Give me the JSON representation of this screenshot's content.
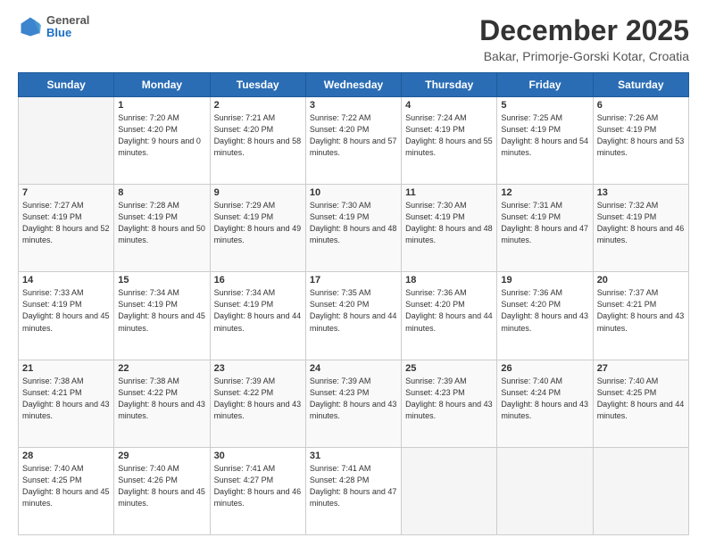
{
  "header": {
    "logo": {
      "general": "General",
      "blue": "Blue"
    },
    "title": "December 2025",
    "location": "Bakar, Primorje-Gorski Kotar, Croatia"
  },
  "days_of_week": [
    "Sunday",
    "Monday",
    "Tuesday",
    "Wednesday",
    "Thursday",
    "Friday",
    "Saturday"
  ],
  "weeks": [
    [
      {
        "day": "",
        "sunrise": "",
        "sunset": "",
        "daylight": ""
      },
      {
        "day": "1",
        "sunrise": "Sunrise: 7:20 AM",
        "sunset": "Sunset: 4:20 PM",
        "daylight": "Daylight: 9 hours and 0 minutes."
      },
      {
        "day": "2",
        "sunrise": "Sunrise: 7:21 AM",
        "sunset": "Sunset: 4:20 PM",
        "daylight": "Daylight: 8 hours and 58 minutes."
      },
      {
        "day": "3",
        "sunrise": "Sunrise: 7:22 AM",
        "sunset": "Sunset: 4:20 PM",
        "daylight": "Daylight: 8 hours and 57 minutes."
      },
      {
        "day": "4",
        "sunrise": "Sunrise: 7:24 AM",
        "sunset": "Sunset: 4:19 PM",
        "daylight": "Daylight: 8 hours and 55 minutes."
      },
      {
        "day": "5",
        "sunrise": "Sunrise: 7:25 AM",
        "sunset": "Sunset: 4:19 PM",
        "daylight": "Daylight: 8 hours and 54 minutes."
      },
      {
        "day": "6",
        "sunrise": "Sunrise: 7:26 AM",
        "sunset": "Sunset: 4:19 PM",
        "daylight": "Daylight: 8 hours and 53 minutes."
      }
    ],
    [
      {
        "day": "7",
        "sunrise": "Sunrise: 7:27 AM",
        "sunset": "Sunset: 4:19 PM",
        "daylight": "Daylight: 8 hours and 52 minutes."
      },
      {
        "day": "8",
        "sunrise": "Sunrise: 7:28 AM",
        "sunset": "Sunset: 4:19 PM",
        "daylight": "Daylight: 8 hours and 50 minutes."
      },
      {
        "day": "9",
        "sunrise": "Sunrise: 7:29 AM",
        "sunset": "Sunset: 4:19 PM",
        "daylight": "Daylight: 8 hours and 49 minutes."
      },
      {
        "day": "10",
        "sunrise": "Sunrise: 7:30 AM",
        "sunset": "Sunset: 4:19 PM",
        "daylight": "Daylight: 8 hours and 48 minutes."
      },
      {
        "day": "11",
        "sunrise": "Sunrise: 7:30 AM",
        "sunset": "Sunset: 4:19 PM",
        "daylight": "Daylight: 8 hours and 48 minutes."
      },
      {
        "day": "12",
        "sunrise": "Sunrise: 7:31 AM",
        "sunset": "Sunset: 4:19 PM",
        "daylight": "Daylight: 8 hours and 47 minutes."
      },
      {
        "day": "13",
        "sunrise": "Sunrise: 7:32 AM",
        "sunset": "Sunset: 4:19 PM",
        "daylight": "Daylight: 8 hours and 46 minutes."
      }
    ],
    [
      {
        "day": "14",
        "sunrise": "Sunrise: 7:33 AM",
        "sunset": "Sunset: 4:19 PM",
        "daylight": "Daylight: 8 hours and 45 minutes."
      },
      {
        "day": "15",
        "sunrise": "Sunrise: 7:34 AM",
        "sunset": "Sunset: 4:19 PM",
        "daylight": "Daylight: 8 hours and 45 minutes."
      },
      {
        "day": "16",
        "sunrise": "Sunrise: 7:34 AM",
        "sunset": "Sunset: 4:19 PM",
        "daylight": "Daylight: 8 hours and 44 minutes."
      },
      {
        "day": "17",
        "sunrise": "Sunrise: 7:35 AM",
        "sunset": "Sunset: 4:20 PM",
        "daylight": "Daylight: 8 hours and 44 minutes."
      },
      {
        "day": "18",
        "sunrise": "Sunrise: 7:36 AM",
        "sunset": "Sunset: 4:20 PM",
        "daylight": "Daylight: 8 hours and 44 minutes."
      },
      {
        "day": "19",
        "sunrise": "Sunrise: 7:36 AM",
        "sunset": "Sunset: 4:20 PM",
        "daylight": "Daylight: 8 hours and 43 minutes."
      },
      {
        "day": "20",
        "sunrise": "Sunrise: 7:37 AM",
        "sunset": "Sunset: 4:21 PM",
        "daylight": "Daylight: 8 hours and 43 minutes."
      }
    ],
    [
      {
        "day": "21",
        "sunrise": "Sunrise: 7:38 AM",
        "sunset": "Sunset: 4:21 PM",
        "daylight": "Daylight: 8 hours and 43 minutes."
      },
      {
        "day": "22",
        "sunrise": "Sunrise: 7:38 AM",
        "sunset": "Sunset: 4:22 PM",
        "daylight": "Daylight: 8 hours and 43 minutes."
      },
      {
        "day": "23",
        "sunrise": "Sunrise: 7:39 AM",
        "sunset": "Sunset: 4:22 PM",
        "daylight": "Daylight: 8 hours and 43 minutes."
      },
      {
        "day": "24",
        "sunrise": "Sunrise: 7:39 AM",
        "sunset": "Sunset: 4:23 PM",
        "daylight": "Daylight: 8 hours and 43 minutes."
      },
      {
        "day": "25",
        "sunrise": "Sunrise: 7:39 AM",
        "sunset": "Sunset: 4:23 PM",
        "daylight": "Daylight: 8 hours and 43 minutes."
      },
      {
        "day": "26",
        "sunrise": "Sunrise: 7:40 AM",
        "sunset": "Sunset: 4:24 PM",
        "daylight": "Daylight: 8 hours and 43 minutes."
      },
      {
        "day": "27",
        "sunrise": "Sunrise: 7:40 AM",
        "sunset": "Sunset: 4:25 PM",
        "daylight": "Daylight: 8 hours and 44 minutes."
      }
    ],
    [
      {
        "day": "28",
        "sunrise": "Sunrise: 7:40 AM",
        "sunset": "Sunset: 4:25 PM",
        "daylight": "Daylight: 8 hours and 45 minutes."
      },
      {
        "day": "29",
        "sunrise": "Sunrise: 7:40 AM",
        "sunset": "Sunset: 4:26 PM",
        "daylight": "Daylight: 8 hours and 45 minutes."
      },
      {
        "day": "30",
        "sunrise": "Sunrise: 7:41 AM",
        "sunset": "Sunset: 4:27 PM",
        "daylight": "Daylight: 8 hours and 46 minutes."
      },
      {
        "day": "31",
        "sunrise": "Sunrise: 7:41 AM",
        "sunset": "Sunset: 4:28 PM",
        "daylight": "Daylight: 8 hours and 47 minutes."
      },
      {
        "day": "",
        "sunrise": "",
        "sunset": "",
        "daylight": ""
      },
      {
        "day": "",
        "sunrise": "",
        "sunset": "",
        "daylight": ""
      },
      {
        "day": "",
        "sunrise": "",
        "sunset": "",
        "daylight": ""
      }
    ]
  ]
}
